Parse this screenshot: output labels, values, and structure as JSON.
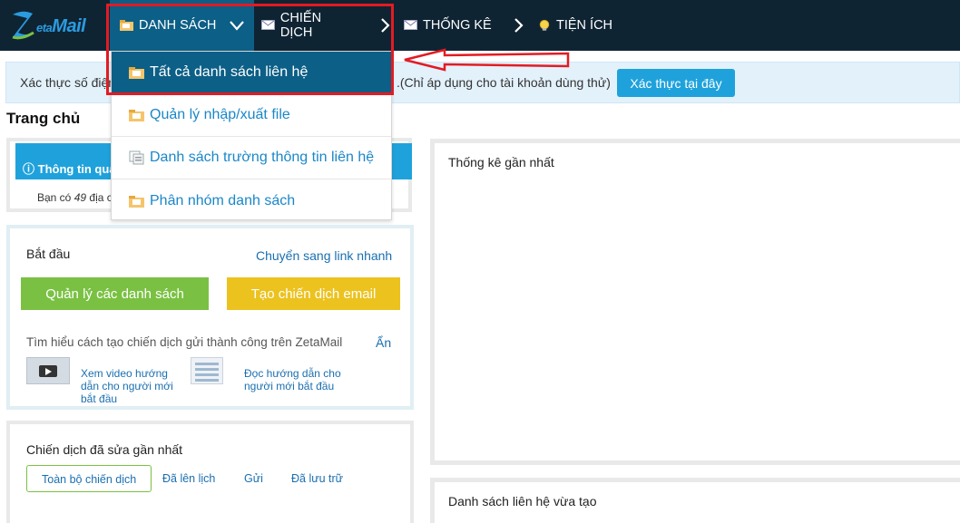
{
  "nav": {
    "logo_z": "Z",
    "logo_eta": "eta",
    "logo_mail": "Mail",
    "items": [
      {
        "label": "DANH SÁCH",
        "icon": "folder-icon"
      },
      {
        "label": "CHIẾN DỊCH",
        "icon": "mail-icon"
      },
      {
        "label": "THỐNG KÊ",
        "icon": "mail-icon"
      },
      {
        "label": "TIỆN ÍCH",
        "icon": "bulb-icon"
      }
    ]
  },
  "dropdown": {
    "items": [
      {
        "label": "Tất cả danh sách liên hệ",
        "icon": "folder-icon"
      },
      {
        "label": "Quản lý nhập/xuất file",
        "icon": "folder-icon"
      },
      {
        "label": "Danh sách trường thông tin liên hệ",
        "icon": "list-icon"
      },
      {
        "label": "Phân nhóm danh sách",
        "icon": "folder-icon"
      }
    ]
  },
  "notice": {
    "text_left": "Xác thực số điện",
    "text_right": ".(Chỉ áp dụng cho tài khoản dùng thử)",
    "button": "Xác thực tại đây"
  },
  "page": {
    "title": "Trang chủ"
  },
  "info_panel": {
    "heading": "Thông tin quan",
    "body_prefix": "Bạn có",
    "body_count": "49",
    "body_suffix": "địa c"
  },
  "start_panel": {
    "title": "Bắt đầu",
    "quick_link": "Chuyển sang link nhanh",
    "btn_manage": "Quản lý các danh sách",
    "btn_create": "Tạo chiến dịch email",
    "learn_text": "Tìm hiểu cách tạo chiến dịch gửi thành công trên ZetaMail",
    "hide_link": "Ẩn",
    "video_link": "Xem video hướng dẫn cho người mới bắt đầu",
    "guide_link": "Đọc hướng dẫn cho người mới bắt đầu"
  },
  "campaign_panel": {
    "title": "Chiến dịch đã sửa gần nhất",
    "tabs": [
      "Toàn bộ chiến dịch",
      "Đã lên lịch",
      "Gửi",
      "Đã lưu trữ"
    ]
  },
  "stats_panel": {
    "title": "Thống kê gần nhất"
  },
  "recent_panel": {
    "title": "Danh sách liên hệ vừa tạo"
  },
  "colors": {
    "nav_bg": "#0f2433",
    "nav_active": "#0c5f86",
    "accent_blue": "#1fa2dc",
    "green": "#7ac143",
    "yellow": "#ecc21f",
    "highlight_red": "#e31b23"
  }
}
